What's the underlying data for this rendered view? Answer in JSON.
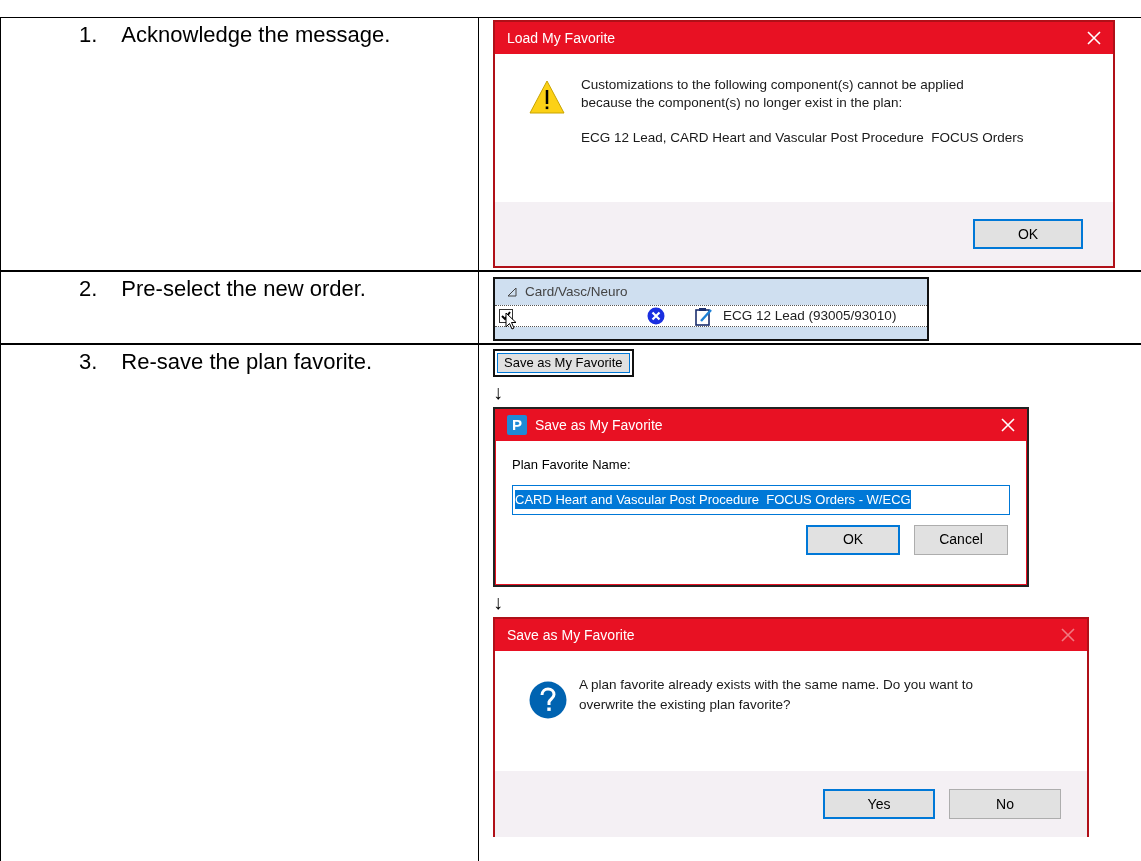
{
  "steps": [
    {
      "number": "1.",
      "text": "Acknowledge the message.",
      "panels": [
        {
          "kind": "warning_dialog",
          "title": "Load My Favorite",
          "close_enabled": true,
          "message": "Customizations to the following component(s) cannot be applied because the component(s) no longer exist in the plan:",
          "detail": "ECG 12 Lead, CARD Heart and Vascular Post Procedure  FOCUS Orders",
          "buttons": [
            {
              "label": "OK",
              "default": true
            }
          ]
        }
      ]
    },
    {
      "number": "2.",
      "text": "Pre-select the new order.",
      "panels": [
        {
          "kind": "order_tree",
          "group": {
            "label": "Card/Vasc/Neuro",
            "expanded": true
          },
          "order": {
            "label": "ECG 12 Lead (93005/93010)",
            "checked": true
          }
        }
      ]
    },
    {
      "number": "3.",
      "text": "Re-save the plan favorite.",
      "panels": [
        {
          "kind": "button",
          "label": "Save as My Favorite"
        },
        {
          "kind": "arrow",
          "glyph": "↓"
        },
        {
          "kind": "name_dialog",
          "title": "Save as My Favorite",
          "logo": "P",
          "close_enabled": true,
          "field_label": "Plan Favorite Name:",
          "value": {
            "text": "CARD Heart and Vascular Post Procedure  FOCUS Orders - W/ECG",
            "selected": true
          },
          "buttons": [
            {
              "label": "OK",
              "default": true
            },
            {
              "label": "Cancel",
              "default": false
            }
          ]
        },
        {
          "kind": "arrow",
          "glyph": "↓"
        },
        {
          "kind": "question_dialog",
          "title": "Save as My Favorite",
          "close_enabled": false,
          "message": "A plan favorite already exists with the same name. Do you want to overwrite the existing plan favorite?",
          "buttons": [
            {
              "label": "Yes",
              "default": true
            },
            {
              "label": "No",
              "default": false
            }
          ]
        }
      ]
    }
  ]
}
